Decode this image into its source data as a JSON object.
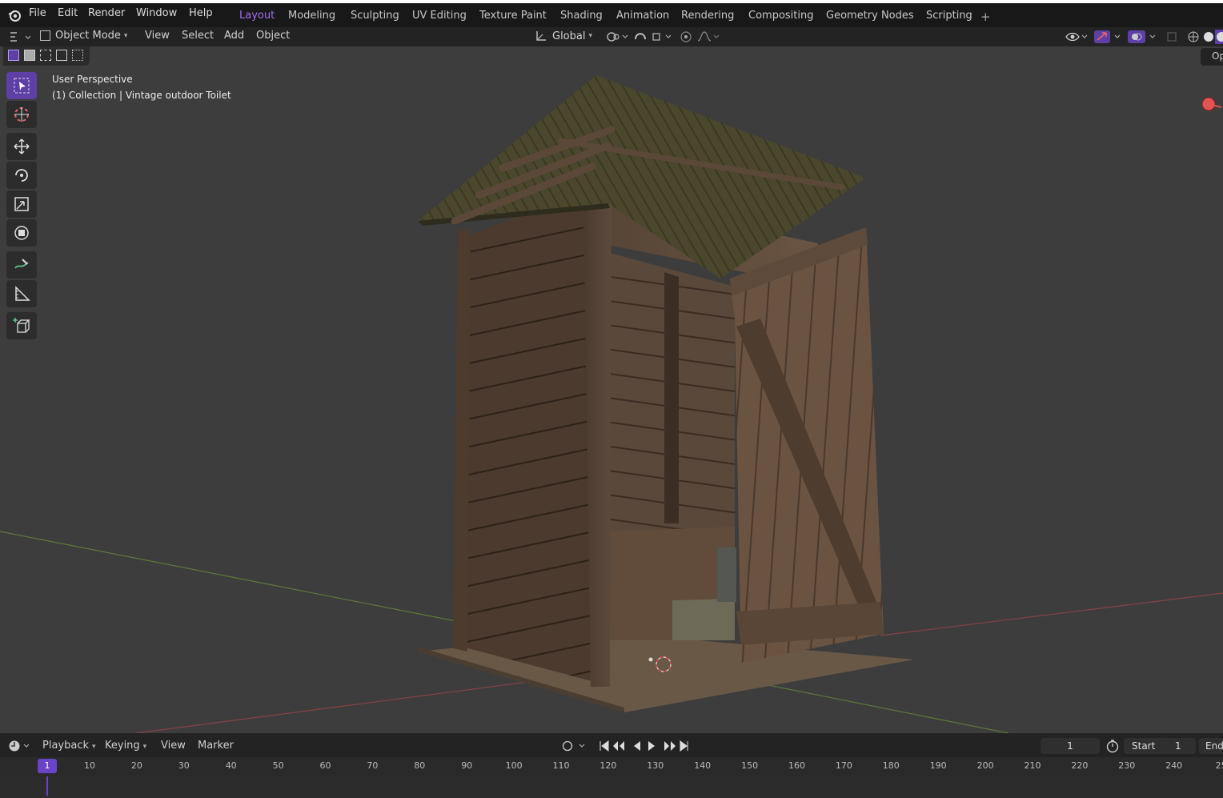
{
  "menu": [
    "File",
    "Edit",
    "Render",
    "Window",
    "Help"
  ],
  "workspaces": [
    {
      "label": "Layout",
      "active": true
    },
    {
      "label": "Modeling"
    },
    {
      "label": "Sculpting"
    },
    {
      "label": "UV Editing"
    },
    {
      "label": "Texture Paint"
    },
    {
      "label": "Shading"
    },
    {
      "label": "Animation"
    },
    {
      "label": "Rendering"
    },
    {
      "label": "Compositing"
    },
    {
      "label": "Geometry Nodes"
    },
    {
      "label": "Scripting"
    }
  ],
  "viewport_header": {
    "mode": "Object Mode",
    "menus": [
      "View",
      "Select",
      "Add",
      "Object"
    ],
    "orientation": "Global"
  },
  "viewport": {
    "perspective_label": "User Perspective",
    "collection_label": "(1) Collection | Vintage outdoor Toilet",
    "options_label": "Op"
  },
  "timeline": {
    "menus": [
      "Playback",
      "Keying",
      "View",
      "Marker"
    ],
    "current_frame": "1",
    "start_label": "Start",
    "start_value": "1",
    "end_label": "End",
    "ticks": [
      "1",
      "10",
      "20",
      "30",
      "40",
      "50",
      "60",
      "70",
      "80",
      "90",
      "100",
      "110",
      "120",
      "130",
      "140",
      "150",
      "160",
      "170",
      "180",
      "190",
      "200",
      "210",
      "220",
      "230",
      "240",
      "25"
    ]
  },
  "colors": {
    "accent": "#a36cf5",
    "active_tool": "#5e3fa6",
    "viewport_bg": "#3d3d3d"
  }
}
